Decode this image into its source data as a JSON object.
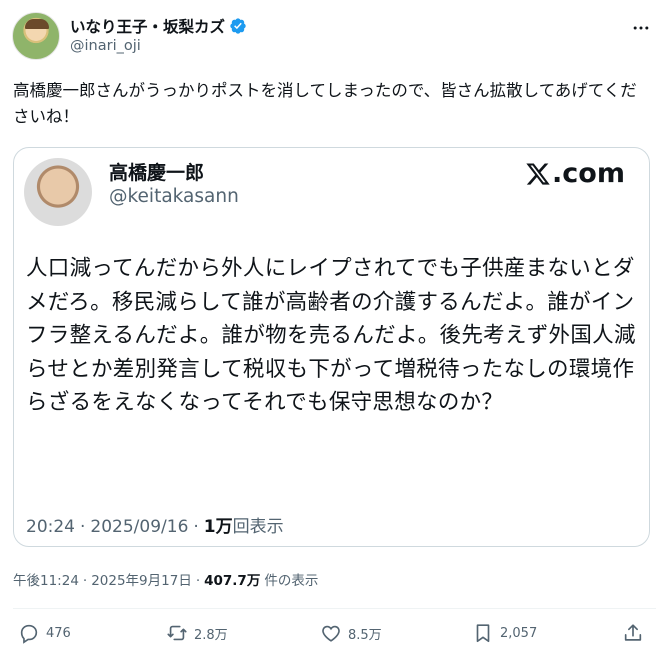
{
  "author": {
    "display_name": "いなり王子・坂梨カズ",
    "handle": "@inari_oji"
  },
  "post": {
    "text": "高橋慶一郎さんがうっかりポストを消してしまったので、皆さん拡散してあげてくださいね！"
  },
  "quoted": {
    "display_name": "高橋慶一郎",
    "handle": "@keitakasann",
    "source_label": ".com",
    "text": "人口減ってんだから外人にレイプされてでも子供産まないとダメだろ。移民減らして誰が高齢者の介護するんだよ。誰がインフラ整えるんだよ。誰が物を売るんだよ。後先考えず外国人減らせとか差別発言して税収も下がって増税待ったなしの環境作らざるをえなくなってそれでも保守思想なのか？",
    "time": "20:24",
    "date": "2025/09/16",
    "views_count": "1万",
    "views_label": "回表示"
  },
  "meta": {
    "time": "午後11:24",
    "date": "2025年9月17日",
    "views_count": "407.7万",
    "views_label": "件の表示"
  },
  "actions": {
    "replies": "476",
    "reposts": "2.8万",
    "likes": "8.5万",
    "bookmarks": "2,057"
  },
  "colors": {
    "text": "#0f1419",
    "muted": "#536471",
    "border": "#cfd9de",
    "verified": "#1d9bf0"
  },
  "icons": [
    "verified-badge-icon",
    "more-icon",
    "x-logo-icon",
    "reply-icon",
    "repost-icon",
    "like-icon",
    "bookmark-icon",
    "share-icon"
  ]
}
